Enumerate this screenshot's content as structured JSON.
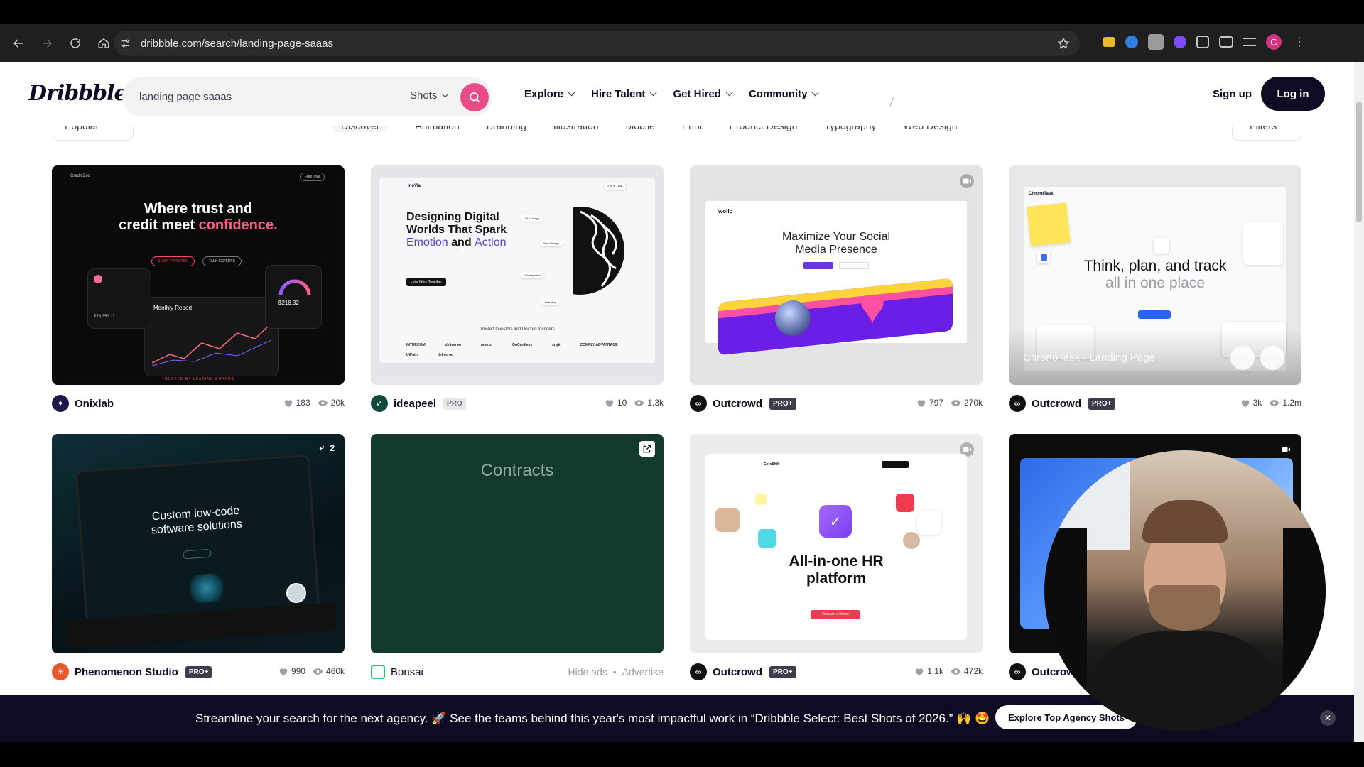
{
  "browser": {
    "url": "dribbble.com/search/landing-page-saaas",
    "profile_initial": "C"
  },
  "header": {
    "logo": "Dribbble",
    "search_value": "landing page saaas",
    "search_type": "Shots",
    "nav": [
      "Explore",
      "Hire Talent",
      "Get Hired",
      "Community"
    ],
    "signup": "Sign up",
    "login": "Log in"
  },
  "filters": {
    "sort": "Popular",
    "categories": [
      "Discover",
      "Animation",
      "Branding",
      "Illustration",
      "Mobile",
      "Print",
      "Product Design",
      "Typography",
      "Web Design"
    ],
    "filters_label": "Filters"
  },
  "shots": [
    {
      "author": "Onixlab",
      "badge": "",
      "likes": "183",
      "views": "20k",
      "avatar_color": "#1c1a4a",
      "preview": {
        "brand": "Credit Zoo",
        "title_a": "Where trust and",
        "title_b": "credit meet ",
        "title_accent": "confidence.",
        "btn1": "START FOR FREE",
        "btn2": "TALK EXPERTS",
        "card_label": "Monthly Report",
        "amount": "$218.32",
        "balance": "$29,352.11",
        "footer": "TRUSTED BY LEADING BRANDS",
        "free_trial": "Free Trial"
      }
    },
    {
      "author": "ideapeel",
      "badge": "PRO",
      "likes": "10",
      "views": "1.3k",
      "avatar_color": "#0f4a3a",
      "preview": {
        "brand": "InoVia",
        "title_a": "Designing Digital",
        "title_b": "Worlds That Spark",
        "title_c": "Emotion",
        "title_and": " and ",
        "title_d": "Action",
        "cta": "Let's Work Together",
        "investors": "Trusted Investors and Unicorn founders",
        "logos": [
          "INTERCOM",
          "deliveroo",
          "",
          "monzo",
          "GoCardless",
          "snyk",
          "COMPLY ADVANTAGE",
          "UiPath",
          "deliveroo"
        ],
        "chip1": "UI/UI Design",
        "chip2": "Web Design",
        "chip3": "Development",
        "chip4": "Branding",
        "lets_talk": "Let's Talk"
      }
    },
    {
      "author": "Outcrowd",
      "badge": "PRO+",
      "likes": "797",
      "views": "270k",
      "avatar_color": "#111111",
      "preview": {
        "brand": "wollo",
        "title_a": "Maximize Your Social",
        "title_b": "Media Presence"
      }
    },
    {
      "author": "Outcrowd",
      "badge": "PRO+",
      "likes": "3k",
      "views": "1.2m",
      "avatar_color": "#111111",
      "preview": {
        "brand": "ChronoTask",
        "title_a": "Think, plan, and track",
        "title_b": "all in one place",
        "overlay": "ChronoTask - Landing Page"
      }
    },
    {
      "author": "Phenomenon Studio",
      "badge": "PRO+",
      "likes": "990",
      "views": "460k",
      "avatar_color": "#e8582a",
      "preview": {
        "title_a": "Custom low-code",
        "title_b": "software solutions",
        "reply_count": "2"
      }
    },
    {
      "author": "Bonsai",
      "badge": "",
      "ad": true,
      "hide_ads": "Hide ads",
      "advertise": "Advertise",
      "avatar_color": "#2fbf71",
      "preview": {
        "title": "Contracts"
      }
    },
    {
      "author": "Outcrowd",
      "badge": "PRO+",
      "likes": "1.1k",
      "views": "472k",
      "avatar_color": "#111111",
      "preview": {
        "brand": "CoreShift",
        "title_a": "All-in-one HR",
        "title_b": "platform",
        "btn": "Request a Demo"
      }
    },
    {
      "author": "Outcrowd",
      "badge": "",
      "likes": "",
      "views": "",
      "avatar_color": "#111111",
      "preview": {}
    }
  ],
  "banner": {
    "message": "Streamline your search for the next agency. 🚀 See the teams behind this year's most impactful work in “Dribbble Select: Best Shots of 2026.” 🙌 🤩",
    "cta": "Explore Top Agency Shots"
  },
  "colors": {
    "brand_pink": "#ea4c89",
    "ink": "#0d0c22",
    "banner_bg": "#0d0c22"
  }
}
